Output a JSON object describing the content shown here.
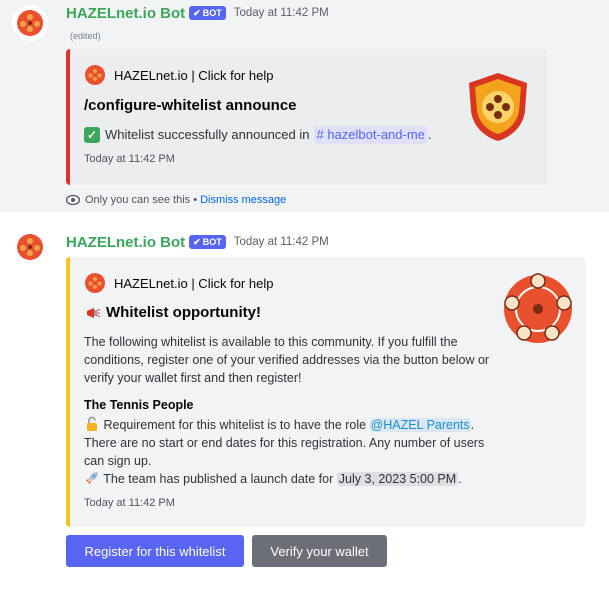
{
  "message1": {
    "username": "HAZELnet.io Bot",
    "badge": "BOT",
    "timestamp": "Today at 11:42 PM",
    "edited": "(edited)",
    "embed": {
      "author": "HAZELnet.io | Click for help",
      "title": "/configure-whitelist announce",
      "description_prefix": "Whitelist successfully announced in",
      "channel_mention": "hazelbot-and-me",
      "description_suffix": ".",
      "footer": "Today at 11:42 PM",
      "border_color": "#e03131"
    },
    "ephemeral_notice": "Only you can see this •",
    "dismiss_label": "Dismiss message"
  },
  "message2": {
    "username": "HAZELnet.io Bot",
    "badge": "BOT",
    "timestamp": "Today at 11:42 PM",
    "embed": {
      "author": "HAZELnet.io | Click for help",
      "title": "Whitelist opportunity!",
      "description": "The following whitelist is available to this community. If you fulfill the conditions, register one of your verified addresses via the button below or verify your wallet first and then register!",
      "field_name": "The Tennis People",
      "requirement_prefix": "Requirement for this whitelist is to have the role",
      "role_mention": "@HAZEL Parents",
      "requirement_suffix": ". There are no start or end dates for this registration. Any number of users can sign up.",
      "launch_prefix": "The team has published a launch date for",
      "launch_date": "July 3, 2023 5:00 PM",
      "launch_suffix": ".",
      "footer": "Today at 11:42 PM",
      "border_color": "#f5c518"
    },
    "buttons": {
      "register": "Register for this whitelist",
      "verify": "Verify your wallet"
    }
  },
  "colors": {
    "username": "#3ba55c",
    "blurple": "#5865f2",
    "secondary_button": "#6d6f78"
  }
}
